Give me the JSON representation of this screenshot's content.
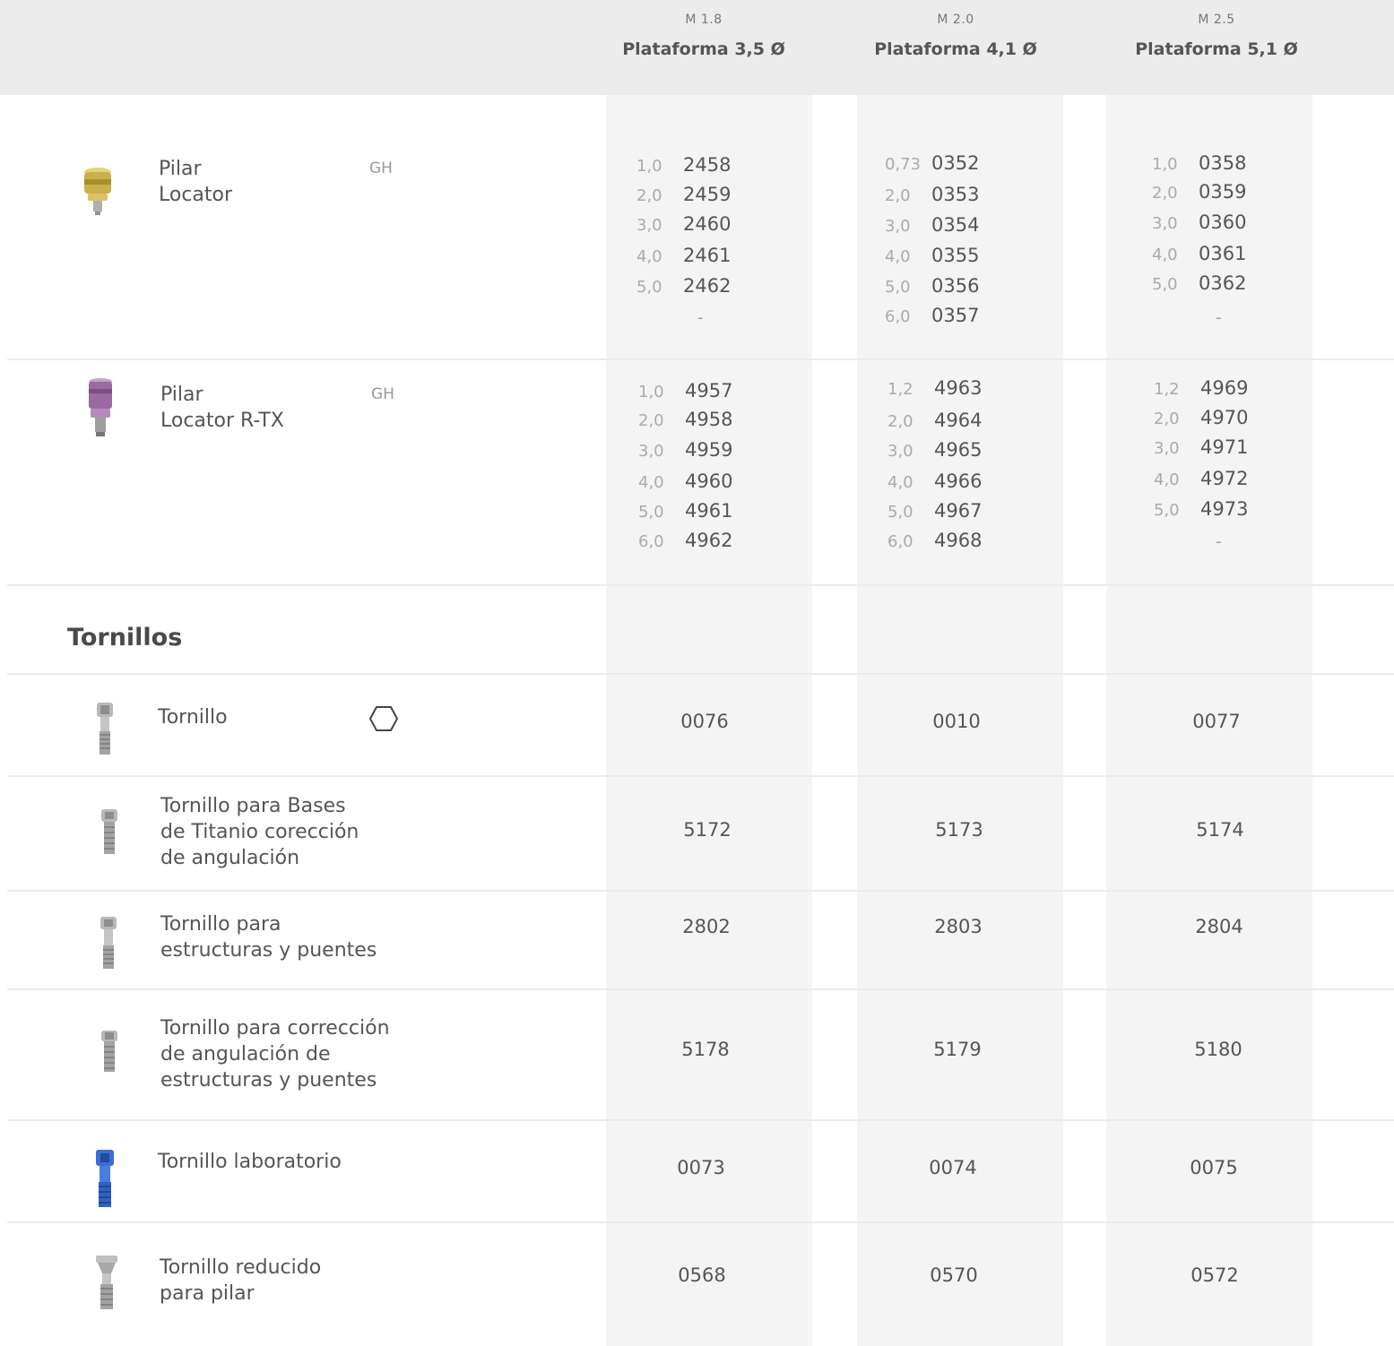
{
  "header": {
    "columns": [
      {
        "m": "M 1.8",
        "platform": "Plataforma 3,5 Ø"
      },
      {
        "m": "M 2.0",
        "platform": "Plataforma 4,1 Ø"
      },
      {
        "m": "M 2.5",
        "platform": "Plataforma 5,1 Ø"
      }
    ]
  },
  "pilares": [
    {
      "name": "Pilar\nLocator",
      "tag": "GH",
      "icon": "gold-abutment-icon",
      "col1": [
        [
          "1,0",
          "2458"
        ],
        [
          "2,0",
          "2459"
        ],
        [
          "3,0",
          "2460"
        ],
        [
          "4,0",
          "2461"
        ],
        [
          "5,0",
          "2462"
        ]
      ],
      "col1_dash": "-",
      "col2": [
        [
          "0,73",
          "0352"
        ],
        [
          "2,0",
          "0353"
        ],
        [
          "3,0",
          "0354"
        ],
        [
          "4,0",
          "0355"
        ],
        [
          "5,0",
          "0356"
        ],
        [
          "6,0",
          "0357"
        ]
      ],
      "col3": [
        [
          "1,0",
          "0358"
        ],
        [
          "2,0",
          "0359"
        ],
        [
          "3,0",
          "0360"
        ],
        [
          "4,0",
          "0361"
        ],
        [
          "5,0",
          "0362"
        ]
      ],
      "col3_dash": "-"
    },
    {
      "name": "Pilar\nLocator R-TX",
      "tag": "GH",
      "icon": "purple-abutment-icon",
      "col1": [
        [
          "1,0",
          "4957"
        ],
        [
          "2,0",
          "4958"
        ],
        [
          "3,0",
          "4959"
        ],
        [
          "4,0",
          "4960"
        ],
        [
          "5,0",
          "4961"
        ],
        [
          "6,0",
          "4962"
        ]
      ],
      "col2": [
        [
          "1,2",
          "4963"
        ],
        [
          "2,0",
          "4964"
        ],
        [
          "3,0",
          "4965"
        ],
        [
          "4,0",
          "4966"
        ],
        [
          "5,0",
          "4967"
        ],
        [
          "6,0",
          "4968"
        ]
      ],
      "col3": [
        [
          "1,2",
          "4969"
        ],
        [
          "2,0",
          "4970"
        ],
        [
          "3,0",
          "4971"
        ],
        [
          "4,0",
          "4972"
        ],
        [
          "5,0",
          "4973"
        ]
      ],
      "col3_dash": "-"
    }
  ],
  "section_title": "Tornillos",
  "tornillos": [
    {
      "name": "Tornillo",
      "icon": "hexagon-icon",
      "codes": [
        "0076",
        "0010",
        "0077"
      ]
    },
    {
      "name": "Tornillo para Bases\nde Titanio corección\nde angulación",
      "codes": [
        "5172",
        "5173",
        "5174"
      ]
    },
    {
      "name": "Tornillo para\nestructuras y puentes",
      "codes": [
        "2802",
        "2803",
        "2804"
      ]
    },
    {
      "name": "Tornillo para corrección\nde angulación de\nestructuras y puentes",
      "codes": [
        "5178",
        "5179",
        "5180"
      ]
    },
    {
      "name": "Tornillo laboratorio",
      "codes": [
        "0073",
        "0074",
        "0075"
      ]
    },
    {
      "name": "Tornillo reducido\npara pilar",
      "codes": [
        "0568",
        "0570",
        "0572"
      ]
    }
  ],
  "colors": {
    "header_bg": "#ececec",
    "column_bg": "#f4f4f4",
    "gold": "#c9b04a",
    "purple": "#9a6aa0",
    "blue": "#2f62c4",
    "titanium": "#a8a8a8"
  }
}
